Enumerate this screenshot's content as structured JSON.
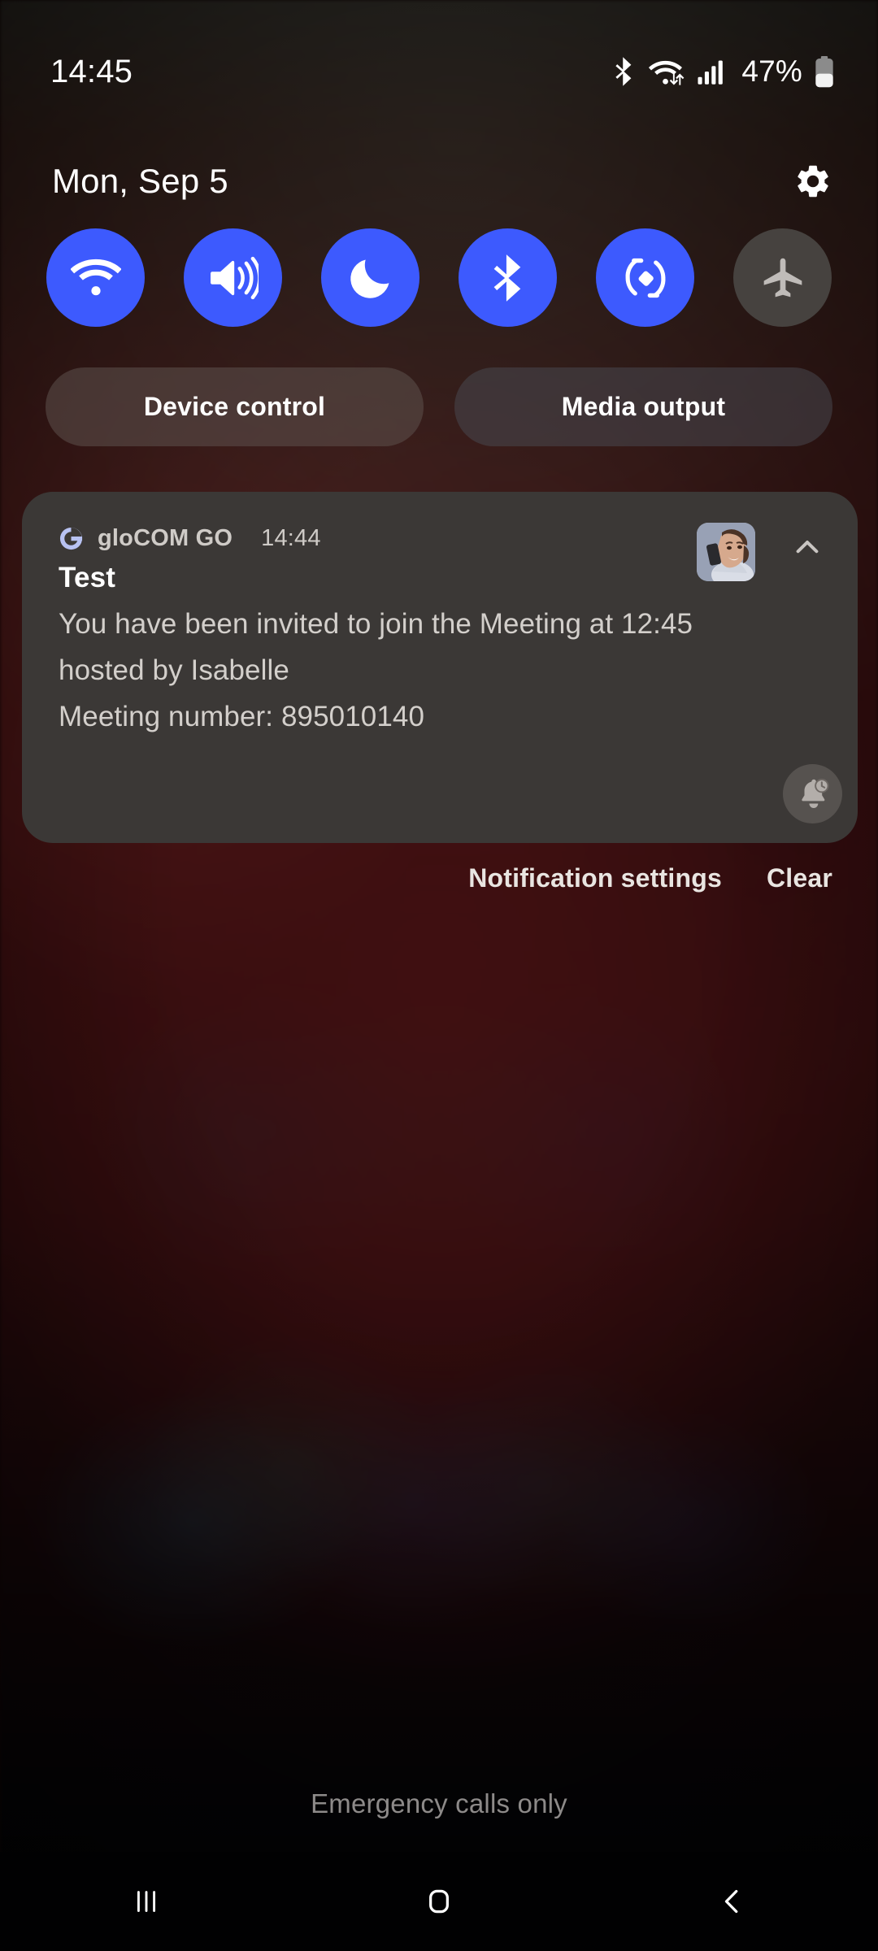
{
  "status_bar": {
    "clock": "14:45",
    "battery_percent": "47%",
    "battery_level": 47,
    "icons": [
      "bluetooth-icon",
      "wifi-icon",
      "signal-icon",
      "battery-icon"
    ]
  },
  "header": {
    "date": "Mon, Sep 5",
    "settings_icon": "gear-icon"
  },
  "quick_settings": {
    "accent_on_color": "#3d5afe",
    "off_color": "#46423f",
    "toggles": [
      {
        "name": "wifi",
        "icon": "wifi-icon",
        "label": "Wi-Fi",
        "active": true
      },
      {
        "name": "sound",
        "icon": "volume-icon",
        "label": "Sound",
        "active": true
      },
      {
        "name": "dark-mode",
        "icon": "moon-icon",
        "label": "Dark mode",
        "active": true
      },
      {
        "name": "bluetooth",
        "icon": "bluetooth-icon",
        "label": "Bluetooth",
        "active": true
      },
      {
        "name": "auto-rotate",
        "icon": "auto-rotate-icon",
        "label": "Auto rotate",
        "active": true
      },
      {
        "name": "airplane",
        "icon": "airplane-icon",
        "label": "Flight mode",
        "active": false
      }
    ]
  },
  "shortcuts": {
    "device_control": "Device control",
    "media_output": "Media output"
  },
  "notification": {
    "app_name": "gloCOM GO",
    "app_icon": "glocom-g-icon",
    "time": "14:44",
    "title": "Test",
    "body_lines": [
      "You have been invited to join the Meeting at 12:45",
      "hosted by Isabelle",
      "Meeting number: 895010140"
    ],
    "avatar": "contact-photo",
    "collapse_icon": "chevron-up-icon",
    "snooze_icon": "bell-clock-icon",
    "card_color": "#3b3836"
  },
  "actions": {
    "notification_settings": "Notification settings",
    "clear": "Clear"
  },
  "footer": {
    "carrier_status": "Emergency calls only"
  },
  "nav_bar": {
    "recents": "recents-icon",
    "home": "home-icon",
    "back": "back-icon"
  }
}
